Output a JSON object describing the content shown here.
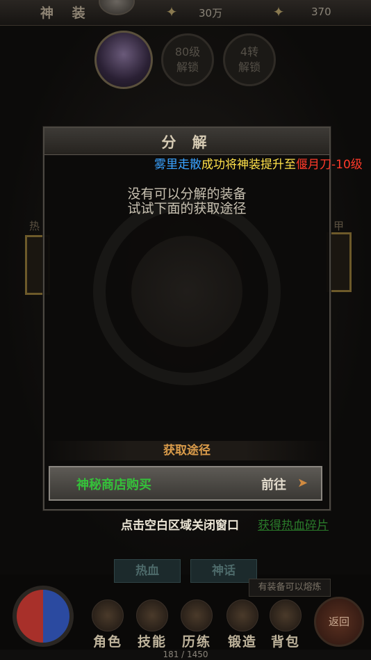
{
  "topbar": {
    "title": "神 装",
    "gold": "30万",
    "ingot": "370"
  },
  "locks": [
    {
      "line1": "80级",
      "line2": "解锁"
    },
    {
      "line1": "4转",
      "line2": "解锁"
    }
  ],
  "side": {
    "left_label": "热",
    "right_label": "甲"
  },
  "modal": {
    "title": "分 解",
    "empty_line1": "没有可以分解的装备",
    "empty_line2": "试试下面的获取途径",
    "ways_title": "获取途径",
    "source": {
      "name": "神秘商店购买",
      "action": "前往"
    }
  },
  "announce": {
    "player": "雾里走散",
    "text": "成功将神装提升至",
    "item": "偃月刀-10级"
  },
  "hints": {
    "close": "点击空白区域关闭窗口",
    "link": "获得热血碎片"
  },
  "tabs": [
    "热血",
    "神话"
  ],
  "notice": "有装备可以熔炼",
  "nav": [
    "角色",
    "技能",
    "历练",
    "锻造",
    "背包"
  ],
  "return_label": "返回",
  "xp": "181 / 1450",
  "colors": {
    "player": "#3aa2ff",
    "text": "#ffe14a",
    "item": "#ff3a2a",
    "source": "#35c03a",
    "ways": "#d99b4a"
  }
}
